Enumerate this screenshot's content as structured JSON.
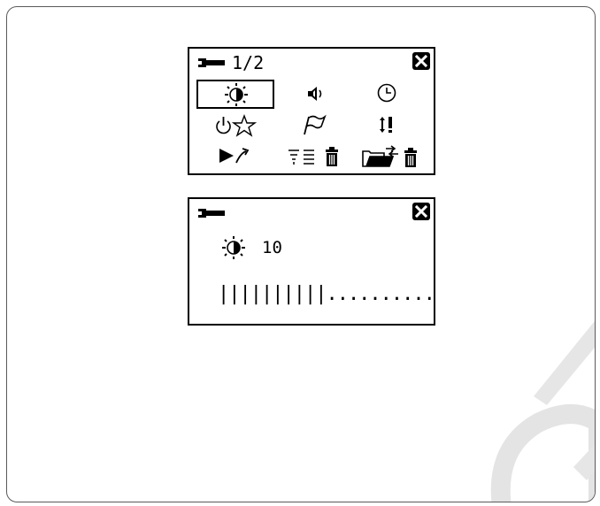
{
  "menu_screen": {
    "header": {
      "icon": "wrench-icon",
      "page": "1/2",
      "close_icon": "close-icon"
    },
    "icon_grid": [
      {
        "icon": "brightness-icon",
        "selected": true
      },
      {
        "icon": "speaker-volume-icon",
        "selected": false
      },
      {
        "icon": "clock-icon",
        "selected": false
      },
      {
        "icon": "power-favorite-icon",
        "selected": false
      },
      {
        "icon": "flag-icon",
        "selected": false
      },
      {
        "icon": "thread-tension-icon",
        "selected": false
      },
      {
        "icon": "play-return-icon",
        "selected": false
      },
      {
        "icon": "clear-list-icon",
        "selected": false
      },
      {
        "icon": "folder-transfer-delete-icon",
        "selected": false
      }
    ]
  },
  "brightness_screen": {
    "header": {
      "icon": "wrench-icon",
      "close_icon": "close-icon"
    },
    "setting_icon": "brightness-icon",
    "value": "10",
    "level_bar": {
      "filled": 10,
      "total": 20,
      "display": "||||||||||.........."
    }
  }
}
